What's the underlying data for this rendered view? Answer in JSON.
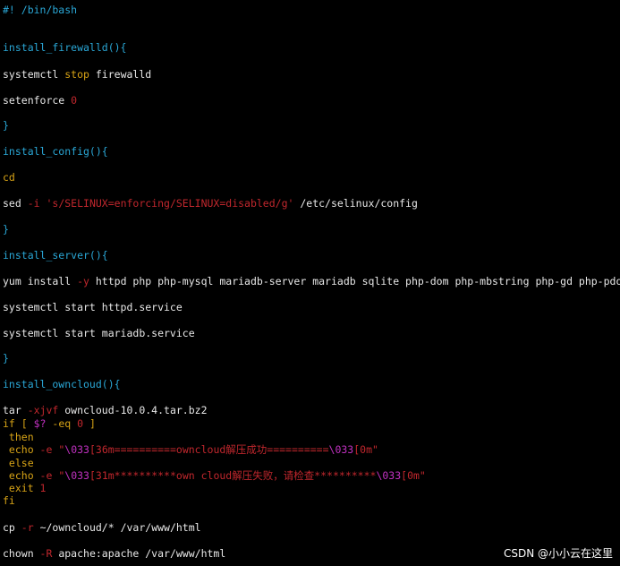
{
  "colors": {
    "background": "#000000",
    "default_text": "#e8e8e8",
    "function_name": "#2aa7d6",
    "keyword": "#d7a316",
    "string": "#c1272d",
    "escape": "#c131c1"
  },
  "lines": [
    [
      {
        "t": "#! /bin/bash",
        "c": "comment"
      }
    ],
    [],
    [
      {
        "t": "install_firewalld(){",
        "c": "func"
      }
    ],
    [
      {
        "t": "systemctl ",
        "c": "default"
      },
      {
        "t": "stop",
        "c": "keyword"
      },
      {
        "t": " firewalld",
        "c": "default"
      }
    ],
    [
      {
        "t": "setenforce ",
        "c": "default"
      },
      {
        "t": "0",
        "c": "number"
      }
    ],
    [
      {
        "t": "}",
        "c": "brace"
      }
    ],
    [
      {
        "t": "install_config(){",
        "c": "func"
      }
    ],
    [
      {
        "t": "cd",
        "c": "keyword"
      }
    ],
    [
      {
        "t": "sed ",
        "c": "default"
      },
      {
        "t": "-i",
        "c": "flag"
      },
      {
        "t": " 's/SELINUX=enforcing/SELINUX=disabled/g'",
        "c": "string"
      },
      {
        "t": " /etc/selinux/config",
        "c": "default"
      }
    ],
    [
      {
        "t": "}",
        "c": "brace"
      }
    ],
    [
      {
        "t": "install_server(){",
        "c": "func"
      }
    ],
    [
      {
        "t": "yum install ",
        "c": "default"
      },
      {
        "t": "-y",
        "c": "flag"
      },
      {
        "t": " httpd php php-mysql mariadb-server mariadb sqlite php-dom php-mbstring php-gd php-pdo",
        "c": "default"
      }
    ],
    [
      {
        "t": "systemctl start httpd.service",
        "c": "default"
      }
    ],
    [
      {
        "t": "systemctl start mariadb.service",
        "c": "default"
      }
    ],
    [
      {
        "t": "}",
        "c": "brace"
      }
    ],
    [
      {
        "t": "install_owncloud(){",
        "c": "func"
      }
    ],
    [
      {
        "t": "tar ",
        "c": "default"
      },
      {
        "t": "-xjvf",
        "c": "flag"
      },
      {
        "t": " owncloud-10.0.4.tar.bz2",
        "c": "default"
      }
    ],
    [
      {
        "t": "if [ ",
        "c": "keyword"
      },
      {
        "t": "$?",
        "c": "var"
      },
      {
        "t": " -eq ",
        "c": "keyword"
      },
      {
        "t": "0",
        "c": "number"
      },
      {
        "t": " ]",
        "c": "keyword"
      }
    ],
    [
      {
        "t": " then",
        "c": "keyword"
      }
    ],
    [
      {
        "t": " echo ",
        "c": "keyword"
      },
      {
        "t": "-e",
        "c": "flag"
      },
      {
        "t": " \"",
        "c": "string"
      },
      {
        "t": "\\033",
        "c": "escape"
      },
      {
        "t": "[36m==========owncloud解压成功==========",
        "c": "string"
      },
      {
        "t": "\\033",
        "c": "escape"
      },
      {
        "t": "[0m\"",
        "c": "string"
      }
    ],
    [
      {
        "t": " else",
        "c": "keyword"
      }
    ],
    [
      {
        "t": " echo ",
        "c": "keyword"
      },
      {
        "t": "-e",
        "c": "flag"
      },
      {
        "t": " \"",
        "c": "string"
      },
      {
        "t": "\\033",
        "c": "escape"
      },
      {
        "t": "[31m**********own cloud解压失败，请检查**********",
        "c": "string"
      },
      {
        "t": "\\033",
        "c": "escape"
      },
      {
        "t": "[0m\"",
        "c": "string"
      }
    ],
    [
      {
        "t": " exit ",
        "c": "keyword"
      },
      {
        "t": "1",
        "c": "number"
      }
    ],
    [
      {
        "t": "fi",
        "c": "keyword"
      }
    ],
    [
      {
        "t": "cp ",
        "c": "default"
      },
      {
        "t": "-r",
        "c": "flag"
      },
      {
        "t": " ~/owncloud/* /var/www/html",
        "c": "default"
      }
    ],
    [
      {
        "t": "chown ",
        "c": "default"
      },
      {
        "t": "-R",
        "c": "flag"
      },
      {
        "t": " apache:apache /var/www/html",
        "c": "default"
      }
    ]
  ],
  "watermark": "CSDN @小小云在这里"
}
